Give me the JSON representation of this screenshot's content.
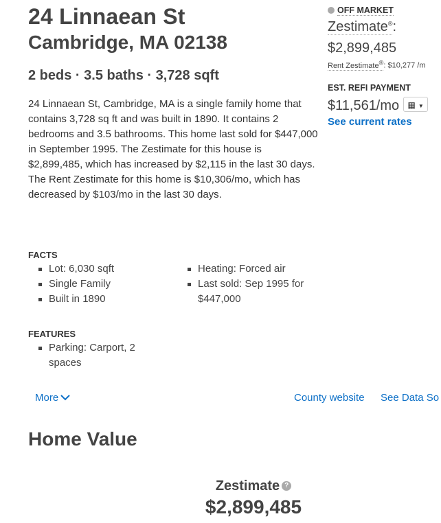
{
  "header": {
    "address_line1": "24 Linnaean St",
    "address_line2": "Cambridge, MA 02138",
    "specs": "2 beds · 3.5 baths · 3,728 sqft"
  },
  "description": "24 Linnaean St, Cambridge, MA is a single family home that contains 3,728 sq ft and was built in 1890. It contains 2 bedrooms and 3.5 bathrooms. This home last sold for $447,000 in September 1995. The Zestimate for this house is $2,899,485, which has increased by $2,115 in the last 30 days. The Rent Zestimate for this home is $10,306/mo, which has decreased by $103/mo in the last 30 days.",
  "sidebar": {
    "status": "OFF MARKET",
    "zestimate_label": "Zestimate",
    "zestimate_sup": "®",
    "zestimate_colon": ":",
    "zestimate_value": "$2,899,485",
    "rent_label": "Rent Zestimate",
    "rent_sup": "®",
    "rent_value": ": $10,277 /m",
    "refi_label": "EST. REFI PAYMENT",
    "refi_value": "$11,561/mo",
    "calc_icon": "calculator-icon",
    "rates_link": "See current rates",
    "colors": {
      "link": "#0d70c7",
      "status_dot": "#aaaaaa"
    }
  },
  "facts": {
    "title": "FACTS",
    "left": [
      "Lot: 6,030 sqft",
      "Single Family",
      "Built in 1890"
    ],
    "right": [
      "Heating: Forced air",
      "Last sold: Sep 1995 for $447,000"
    ]
  },
  "features": {
    "title": "FEATURES",
    "items": [
      "Parking: Carport, 2 spaces"
    ]
  },
  "links": {
    "more": "More",
    "county": "County website",
    "see_data": "See Data So"
  },
  "home_value": {
    "title": "Home Value",
    "zestimate_label": "Zestimate",
    "info_icon": "info-icon",
    "zestimate_value": "$2,899,485"
  }
}
